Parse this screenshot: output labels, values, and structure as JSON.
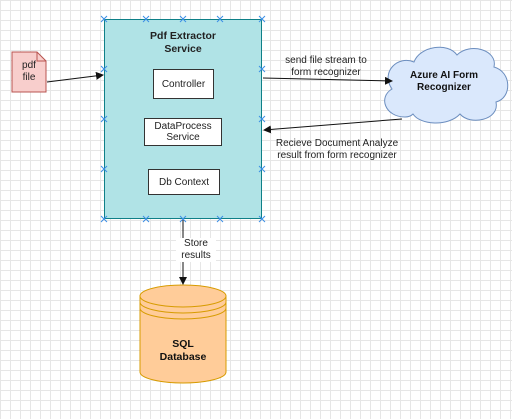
{
  "service": {
    "title_line1": "Pdf Extractor",
    "title_line2": "Service"
  },
  "components": {
    "controller": "Controller",
    "dataprocess_line1": "DataProcess",
    "dataprocess_line2": "Service",
    "dbcontext": "Db Context"
  },
  "pdf_file": {
    "line1": "pdf",
    "line2": "file"
  },
  "cloud": {
    "line1": "Azure AI Form",
    "line2": "Recognizer"
  },
  "database": {
    "line1": "SQL",
    "line2": "Database"
  },
  "edges": {
    "send_line1": "send file stream to",
    "send_line2": "form recognizer",
    "receive_line1": "Recieve Document Analyze",
    "receive_line2": "result from form recognizer",
    "store_line1": "Store",
    "store_line2": "results"
  },
  "colors": {
    "service_fill": "#b0e3e6",
    "service_stroke": "#0e8088",
    "file_fill": "#f8cecc",
    "file_stroke": "#b85450",
    "cloud_fill": "#dae8fc",
    "cloud_stroke": "#6c8ebf",
    "db_fill": "#ffcc99",
    "db_stroke": "#d79b00",
    "selection_handle": "#3a8ee6"
  }
}
